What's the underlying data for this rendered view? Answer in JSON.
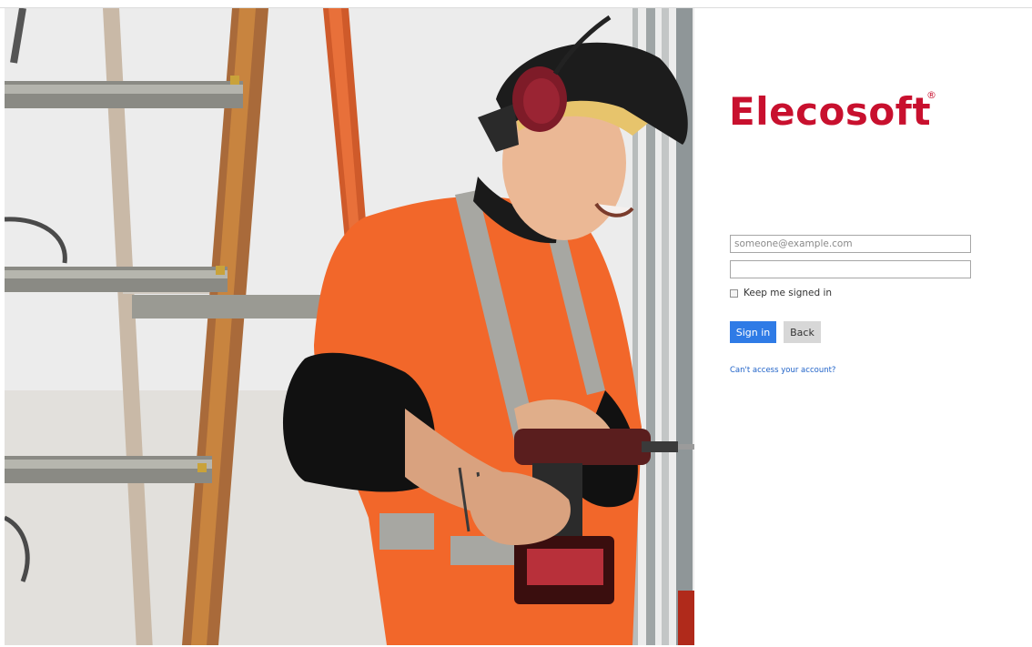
{
  "brand": {
    "name": "Elecosoft",
    "registered_mark": "®",
    "color": "#c8102e"
  },
  "hero_image": {
    "icon": "worker-photo"
  },
  "login": {
    "email_placeholder": "someone@example.com",
    "email_value": "",
    "password_value": "",
    "keep_signed_in_label": "Keep me signed in",
    "keep_signed_in_checked": false,
    "sign_in_label": "Sign in",
    "back_label": "Back",
    "help_link": "Can't access your account?"
  },
  "colors": {
    "primary_button": "#2f7be6",
    "secondary_button": "#d7d7d7",
    "link": "#1f62c8"
  }
}
